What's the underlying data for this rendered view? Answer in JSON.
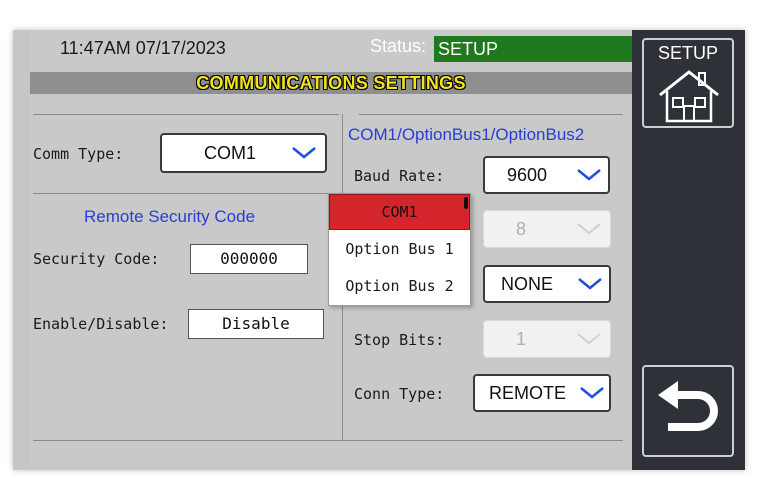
{
  "header": {
    "datetime": "11:47AM 07/17/2023",
    "status_label": "Status:",
    "status_value": "SETUP",
    "title": "COMMUNICATIONS SETTINGS"
  },
  "left_panel": {
    "comm_type": {
      "label": "Comm Type:",
      "value": "COM1"
    },
    "security_heading": "Remote Security Code",
    "security_code": {
      "label": "Security Code:",
      "value": "000000"
    },
    "enable_disable": {
      "label": "Enable/Disable:",
      "value": "Disable"
    }
  },
  "right_panel": {
    "heading": "COM1/OptionBus1/OptionBus2",
    "baud_rate": {
      "label": "Baud Rate:",
      "value": "9600"
    },
    "data_bits": {
      "value": "8",
      "disabled": true
    },
    "parity": {
      "value": "NONE"
    },
    "stop_bits": {
      "label": "Stop Bits:",
      "value": "1",
      "disabled": true
    },
    "conn_type": {
      "label": "Conn Type:",
      "value": "REMOTE"
    }
  },
  "comm_type_popup": {
    "options": [
      "COM1",
      "Option Bus 1",
      "Option Bus 2"
    ],
    "selected": "COM1"
  },
  "sidebar": {
    "setup_button_label": "SETUP",
    "setup_icon": "house-icon",
    "back_icon": "back-arrow-icon"
  },
  "colors": {
    "status_green": "#1f7a1f",
    "title_yellow": "#f3e21d",
    "heading_blue": "#2a3cd6",
    "chevron_blue": "#1d4fe0",
    "selected_red": "#d4252c",
    "sidebar_dark": "#2e3238"
  }
}
